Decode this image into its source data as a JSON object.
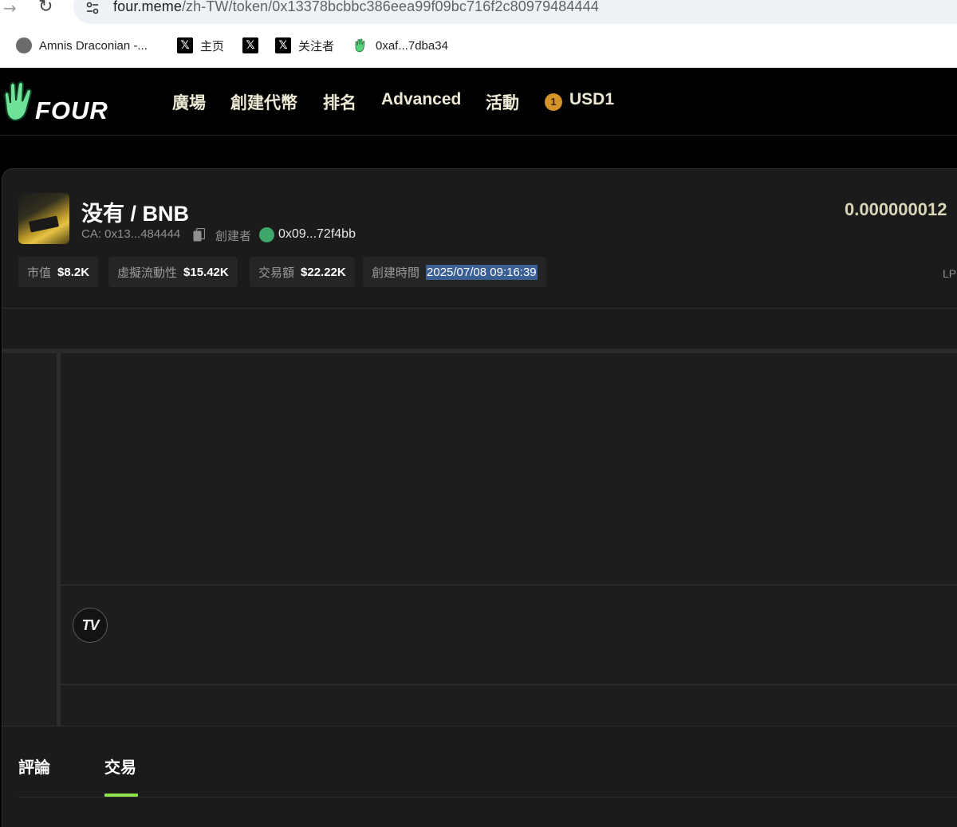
{
  "browser": {
    "url_host": "four.meme",
    "url_path": "/zh-TW/token/0x13378bcbbc386eea99f09bc716f2c80979484444",
    "bookmarks": [
      {
        "label": "Amnis Draconian -...",
        "icon": "globe-icon"
      },
      {
        "label": "主页",
        "icon": "x-icon"
      },
      {
        "label": "",
        "icon": "x-icon"
      },
      {
        "label": "关注者",
        "icon": "x-icon"
      },
      {
        "label": "0xaf...7dba34",
        "icon": "hand-icon"
      }
    ]
  },
  "header": {
    "logo_text": "FOUR",
    "nav": [
      "廣場",
      "創建代幣",
      "排名",
      "Advanced",
      "活動"
    ],
    "currency_badge": "1",
    "currency": "USD1"
  },
  "token": {
    "pair": "没有 / BNB",
    "ca": "CA: 0x13...484444",
    "creator_label": "創建者",
    "creator_address": "0x09...72f4bb",
    "price": "0.000000012",
    "lp_label": "LP",
    "stats": [
      {
        "label": "市值",
        "value": "$8.2K"
      },
      {
        "label": "虛擬流動性",
        "value": "$15.42K"
      },
      {
        "label": "交易額",
        "value": "$22.22K"
      },
      {
        "label": "創建時間",
        "value": "2025/07/08 09:16:39"
      }
    ]
  },
  "chart": {
    "logo": "TV"
  },
  "tabs": [
    {
      "label": "評論",
      "active": false
    },
    {
      "label": "交易",
      "active": true
    }
  ],
  "colors": {
    "accent": "#8fe24a",
    "nav_text": "#ece8d4",
    "selection": "#3a5f94"
  }
}
